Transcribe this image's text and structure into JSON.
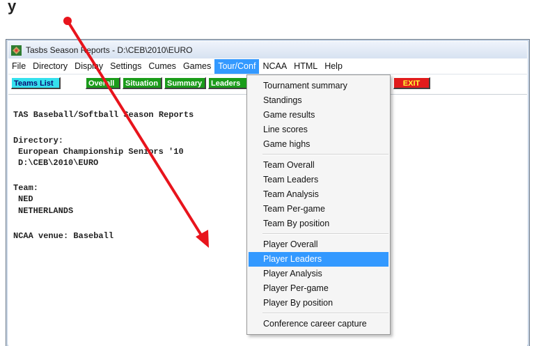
{
  "page_fragment": "y",
  "window": {
    "title": "Tasbs Season Reports - D:\\CEB\\2010\\EURO"
  },
  "menubar": {
    "items": [
      "File",
      "Directory",
      "Display",
      "Settings",
      "Cumes",
      "Games",
      "Tour/Conf",
      "NCAA",
      "HTML",
      "Help"
    ],
    "active": "Tour/Conf"
  },
  "toolbar": {
    "teams_list": "Teams List",
    "overall": "Overall",
    "situation": "Situation",
    "summary": "Summary",
    "leaders": "Leaders",
    "exit": "EXIT"
  },
  "content": {
    "heading": "TAS Baseball/Softball Season Reports",
    "directory_label": "Directory:",
    "directory_name": "European Championship Seniors '10",
    "directory_path": "D:\\CEB\\2010\\EURO",
    "team_label": "Team:",
    "team_code": "NED",
    "team_name": "NETHERLANDS",
    "ncaa_venue": "NCAA venue: Baseball"
  },
  "dropdown": {
    "items": [
      "Tournament summary",
      "Standings",
      "Game results",
      "Line scores",
      "Game highs",
      "Team Overall",
      "Team Leaders",
      "Team Analysis",
      "Team Per-game",
      "Team By position",
      "Player Overall",
      "Player Leaders",
      "Player Analysis",
      "Player Per-game",
      "Player By position",
      "Conference career capture"
    ],
    "highlighted": "Player Leaders"
  },
  "colors": {
    "menu_highlight": "#3399ff",
    "teams_button": "#35e1ee",
    "green_buttons": "#1a9c1a",
    "exit_button": "#e11c1c",
    "annotation_arrow": "#e8141c"
  }
}
